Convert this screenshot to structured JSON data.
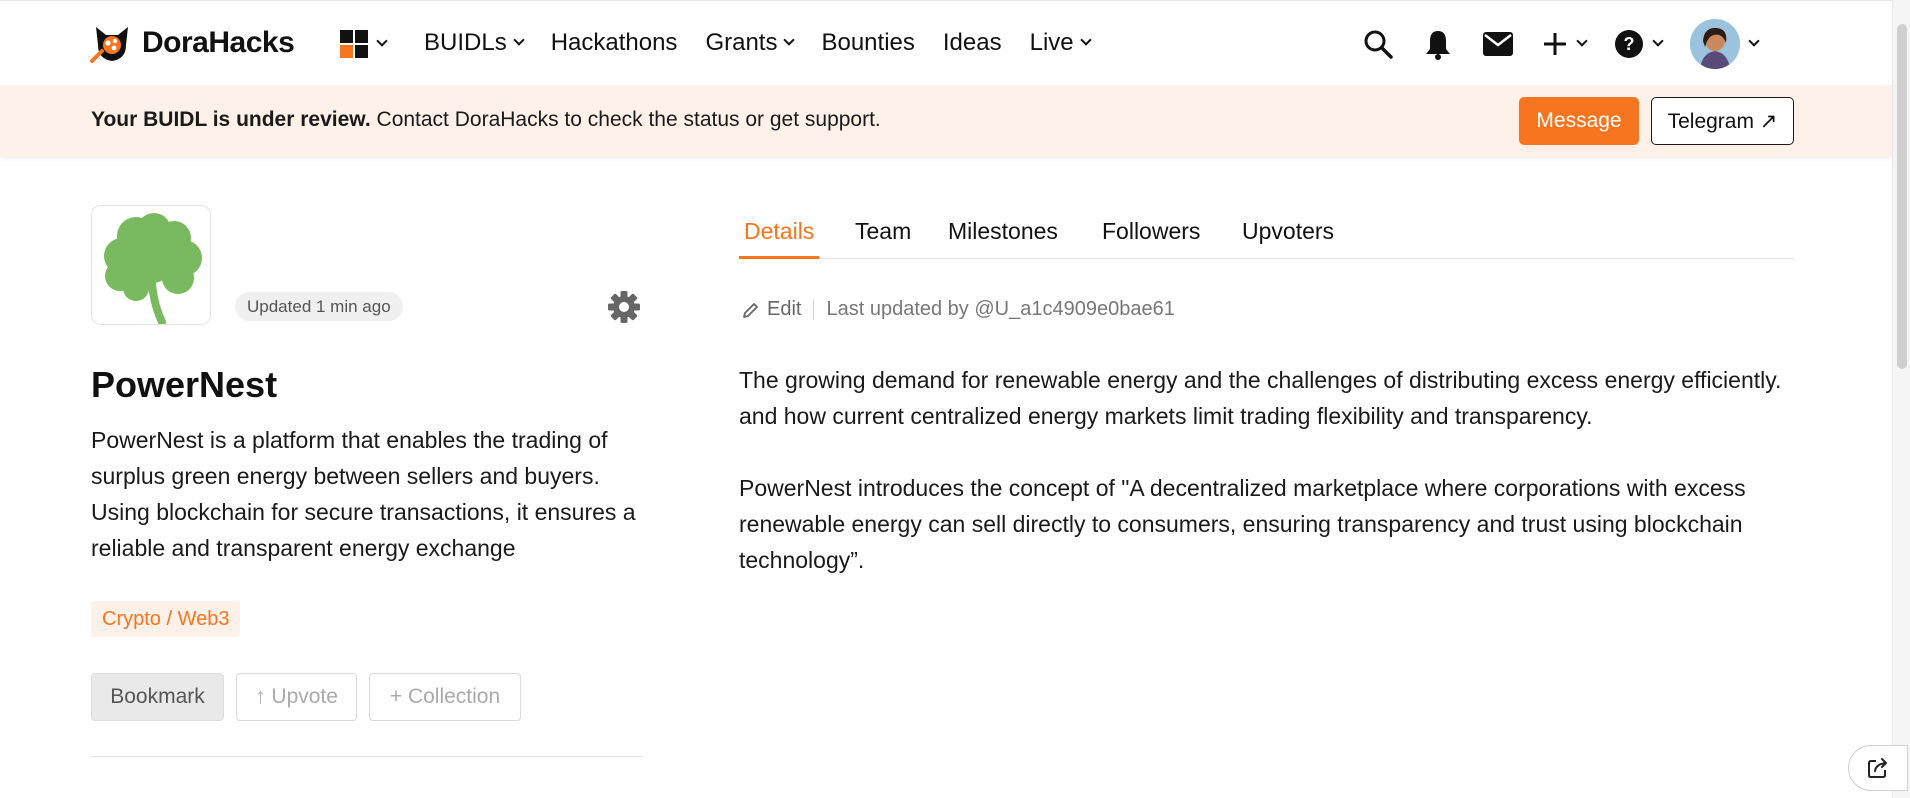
{
  "brand": {
    "name": "DoraHacks"
  },
  "nav": {
    "links": [
      {
        "label": "BUIDLs",
        "has_menu": true
      },
      {
        "label": "Hackathons",
        "has_menu": false
      },
      {
        "label": "Grants",
        "has_menu": true
      },
      {
        "label": "Bounties",
        "has_menu": false
      },
      {
        "label": "Ideas",
        "has_menu": false
      },
      {
        "label": "Live",
        "has_menu": true
      }
    ],
    "right_icons": [
      "search-icon",
      "bell-icon",
      "mail-icon",
      "plus-icon",
      "help-icon",
      "avatar"
    ]
  },
  "banner": {
    "bold": "Your BUIDL is under review.",
    "text": " Contact DoraHacks to check the status or get support.",
    "message_label": "Message",
    "telegram_label": "Telegram ↗"
  },
  "project": {
    "updated": "Updated 1 min ago",
    "name": "PowerNest",
    "description": "PowerNest is a platform that enables the trading of surplus green energy between sellers and buyers. Using blockchain for secure transactions, it ensures a reliable and transparent energy exchange",
    "tag": "Crypto / Web3",
    "actions": {
      "bookmark": "Bookmark",
      "upvote": "↑ Upvote",
      "collection": "+ Collection"
    }
  },
  "tabs": [
    {
      "label": "Details",
      "active": true
    },
    {
      "label": "Team",
      "active": false
    },
    {
      "label": "Milestones",
      "active": false
    },
    {
      "label": "Followers",
      "active": false
    },
    {
      "label": "Upvoters",
      "active": false
    }
  ],
  "details": {
    "edit_label": "Edit",
    "last_updated": "Last updated by @U_a1c4909e0bae61",
    "paragraphs": [
      "The growing demand for renewable energy and the challenges of distributing excess energy efficiently. and how current centralized energy markets limit trading flexibility and transparency.",
      "PowerNest introduces the concept of \"A decentralized marketplace where corporations with excess renewable energy can sell directly to consumers, ensuring transparency and trust using blockchain technology”."
    ]
  },
  "colors": {
    "accent": "#f7751f",
    "banner_bg": "#fef1ea",
    "clover": "#79b95f"
  }
}
